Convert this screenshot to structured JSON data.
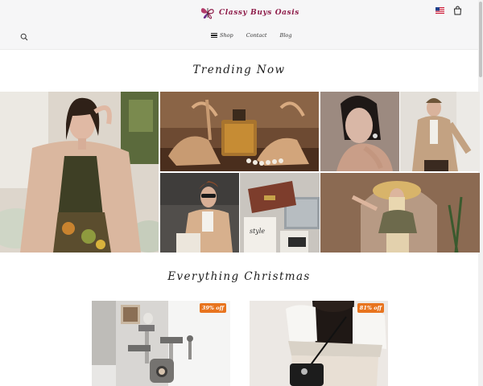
{
  "header": {
    "logo_text": "Classy Buys Oasis",
    "nav": [
      {
        "label": "Shop"
      },
      {
        "label": "Contact"
      },
      {
        "label": "Blog"
      }
    ],
    "icons": [
      "search-icon",
      "us-flag-icon",
      "shopping-bag-icon",
      "hamburger-menu-icon",
      "butterfly-logo-icon"
    ]
  },
  "sections": {
    "trending_title": "Trending Now",
    "christmas_title": "Everything Christmas"
  },
  "mosaic_tiles": [
    "woman-beige-cardigan",
    "sandals-perfume-pearls",
    "woman-earring-portrait",
    "man-beige-trenchcoat",
    "woman-sunglasses-beige-blazer",
    "handbag-laptop-flatlay",
    "woman-sunhat-archway"
  ],
  "products": [
    {
      "badge": "39% off"
    },
    {
      "badge": "81% off"
    }
  ],
  "colors": {
    "brand": "#8e1d4a",
    "badge": "#e8741e",
    "header_bg": "#f6f6f7"
  }
}
